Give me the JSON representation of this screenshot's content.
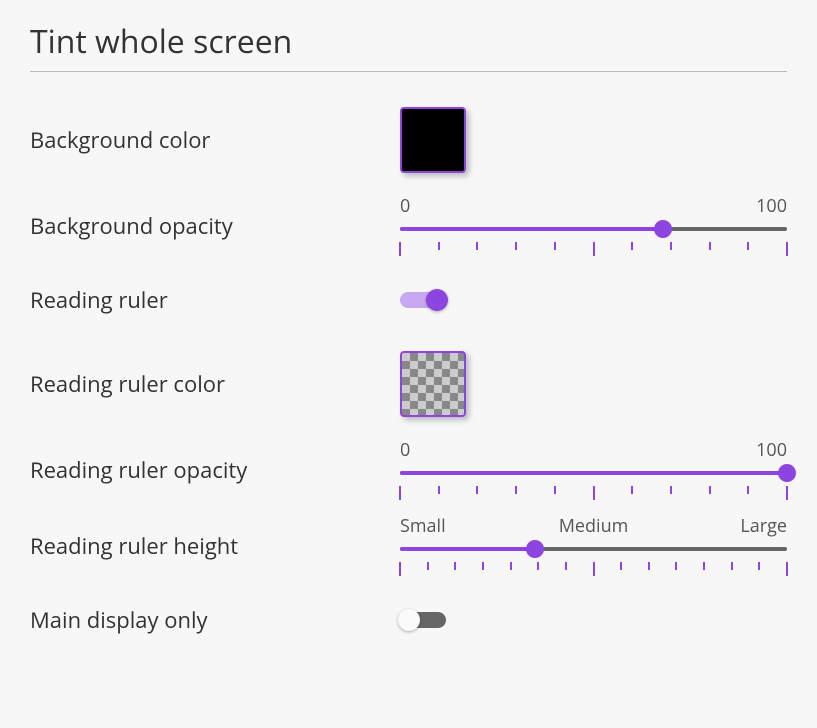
{
  "title": "Tint whole screen",
  "rows": {
    "bg_color": {
      "label": "Background color",
      "swatch_color": "#000000"
    },
    "bg_opacity": {
      "label": "Background opacity",
      "min_label": "0",
      "max_label": "100",
      "value": 68,
      "min": 0,
      "max": 100
    },
    "reading_ruler": {
      "label": "Reading ruler",
      "on": true
    },
    "ruler_color": {
      "label": "Reading ruler color",
      "swatch": "transparent"
    },
    "ruler_opacity": {
      "label": "Reading ruler opacity",
      "min_label": "0",
      "max_label": "100",
      "value": 100,
      "min": 0,
      "max": 100
    },
    "ruler_height": {
      "label": "Reading ruler height",
      "labels": [
        "Small",
        "Medium",
        "Large"
      ],
      "value": 35,
      "min": 0,
      "max": 100
    },
    "main_display": {
      "label": "Main display only",
      "on": false
    }
  },
  "colors": {
    "accent": "#8e44e0"
  }
}
